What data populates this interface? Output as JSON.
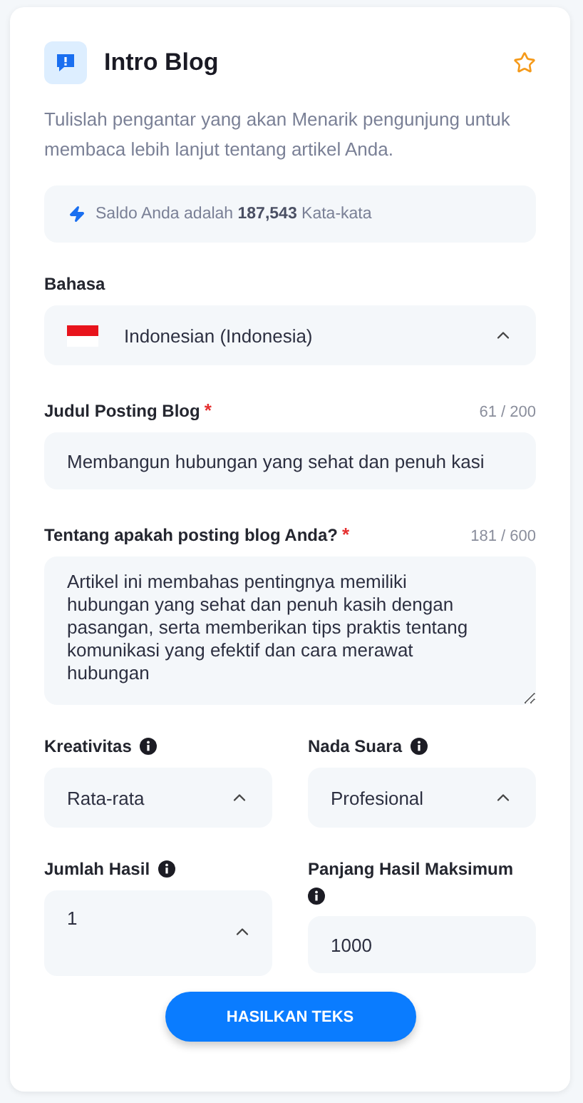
{
  "header": {
    "title": "Intro Blog",
    "favorite": false
  },
  "description": "Tulislah pengantar yang akan Menarik pengunjung untuk membaca lebih lanjut tentang artikel Anda.",
  "balance": "Saldo Anda adalah **187,543** Kata-kata",
  "language": {
    "label": "Bahasa",
    "value": "Indonesian (Indonesia)",
    "expanded": true
  },
  "blog_title": {
    "label": "Judul Posting Blog",
    "required_mark": "*",
    "counter": "61 / 200",
    "value": "Membangun hubungan yang sehat dan penuh kasi"
  },
  "topic": {
    "label": "Tentang apakah posting blog Anda?",
    "required_mark": "*",
    "counter": "181 / 600",
    "value": "Artikel ini membahas pentingnya memiliki hubungan yang sehat dan penuh kasih dengan pasangan, serta memberikan tips praktis tentang komunikasi yang efektif dan cara merawat hubungan"
  },
  "options": [
    {
      "kind": "select",
      "label": "Kreativitas",
      "value": "Rata-rata",
      "expanded": true
    },
    {
      "kind": "select",
      "label": "Nada Suara",
      "value": "Profesional",
      "expanded": true
    },
    {
      "kind": "select",
      "label": "Jumlah Hasil",
      "value": "1",
      "expanded": true
    },
    {
      "kind": "input",
      "label": "Panjang Hasil Maksimum",
      "value": "1000"
    }
  ],
  "button": "HASILKAN TEKS"
}
